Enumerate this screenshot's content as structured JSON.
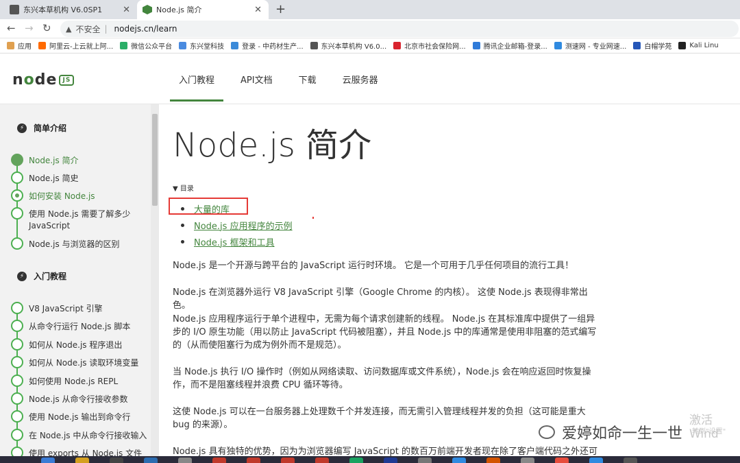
{
  "browser": {
    "tabs": [
      {
        "label": "东兴本草机构 V6.0SP1",
        "active": false
      },
      {
        "label": "Node.js 简介",
        "active": true
      }
    ],
    "new_tab": "+",
    "nav": {
      "back": "←",
      "forward": "→",
      "reload": "↻"
    },
    "security": "不安全",
    "url": "nodejs.cn/learn",
    "bookmarks": [
      {
        "label": "应用",
        "color": "#e0a050"
      },
      {
        "label": "阿里云-上云就上阿...",
        "color": "#ff6a00"
      },
      {
        "label": "微信公众平台",
        "color": "#2aae67"
      },
      {
        "label": "东兴堂科技",
        "color": "#4a8be0"
      },
      {
        "label": "登录 - 中药材生产...",
        "color": "#3b8ad9"
      },
      {
        "label": "东兴本草机构 V6.0...",
        "color": "#555555"
      },
      {
        "label": "北京市社会保险网...",
        "color": "#d9232e"
      },
      {
        "label": "腾讯企业邮箱-登录...",
        "color": "#2f7bd9"
      },
      {
        "label": "测速网 - 专业网速...",
        "color": "#2f8ae0"
      },
      {
        "label": "白帽学苑",
        "color": "#2556b8"
      },
      {
        "label": "Kali Linu",
        "color": "#222222"
      }
    ]
  },
  "site": {
    "logo": {
      "n": "n",
      "o": "o",
      "de": "de",
      "js": "JS"
    },
    "nav": [
      {
        "label": "入门教程",
        "active": true
      },
      {
        "label": "API文档",
        "active": false
      },
      {
        "label": "下载",
        "active": false
      },
      {
        "label": "云服务器",
        "active": false
      }
    ]
  },
  "sidebar": {
    "section1": "简单介绍",
    "section1_items": [
      {
        "label": "Node.js 简介",
        "state": "active"
      },
      {
        "label": "Node.js 简史",
        "state": "empty"
      },
      {
        "label": "如何安装 Node.js",
        "state": "dot"
      },
      {
        "label": "使用 Node.js 需要了解多少 JavaScript",
        "state": "empty"
      },
      {
        "label": "Node.js 与浏览器的区别",
        "state": "empty"
      }
    ],
    "section2": "入门教程",
    "section2_items": [
      {
        "label": "V8 JavaScript 引擎"
      },
      {
        "label": "从命令行运行 Node.js 脚本"
      },
      {
        "label": "如何从 Node.js 程序退出"
      },
      {
        "label": "如何从 Node.js 读取环境变量"
      },
      {
        "label": "如何使用 Node.js REPL"
      },
      {
        "label": "Node.js 从命令行接收参数"
      },
      {
        "label": "使用 Node.js 输出到命令行"
      },
      {
        "label": "在 Node.js 中从命令行接收输入"
      },
      {
        "label": "使用 exports 从 Node.js 文件中"
      }
    ]
  },
  "main": {
    "title": "Node.js 简介",
    "toc_label": "▼ 目录",
    "toc": [
      "大量的库",
      "Node.js 应用程序的示例",
      "Node.js 框架和工具"
    ],
    "paragraphs": [
      "Node.js 是一个开源与跨平台的 JavaScript 运行时环境。 它是一个可用于几乎任何项目的流行工具！",
      "Node.js 在浏览器外运行 V8 JavaScript 引擎（Google Chrome 的内核）。 这使 Node.js 表现得非常出色。",
      "Node.js 应用程序运行于单个进程中，无需为每个请求创建新的线程。 Node.js 在其标准库中提供了一组异步的 I/O 原生功能（用以防止 JavaScript 代码被阻塞），并且 Node.js 中的库通常是使用非阻塞的范式编写的（从而使阻塞行为成为例外而不是规范）。",
      "当 Node.js 执行 I/O 操作时（例如从网络读取、访问数据库或文件系统），Node.js 会在响应返回时恢复操作，而不是阻塞线程并浪费 CPU 循环等待。",
      "这使 Node.js 可以在一台服务器上处理数千个并发连接，而无需引入管理线程并发的负担（这可能是重大 bug 的来源）。",
      "Node.js 具有独特的优势，因为为浏览器编写 JavaScript 的数百万前端开发者现在除了客户端代码之外还可以"
    ]
  },
  "overlay": {
    "activate_windows": "激活 Wind",
    "activate_sub": "转到\"设置\"",
    "wechat_watermark": "爱婷如命一生一世"
  }
}
